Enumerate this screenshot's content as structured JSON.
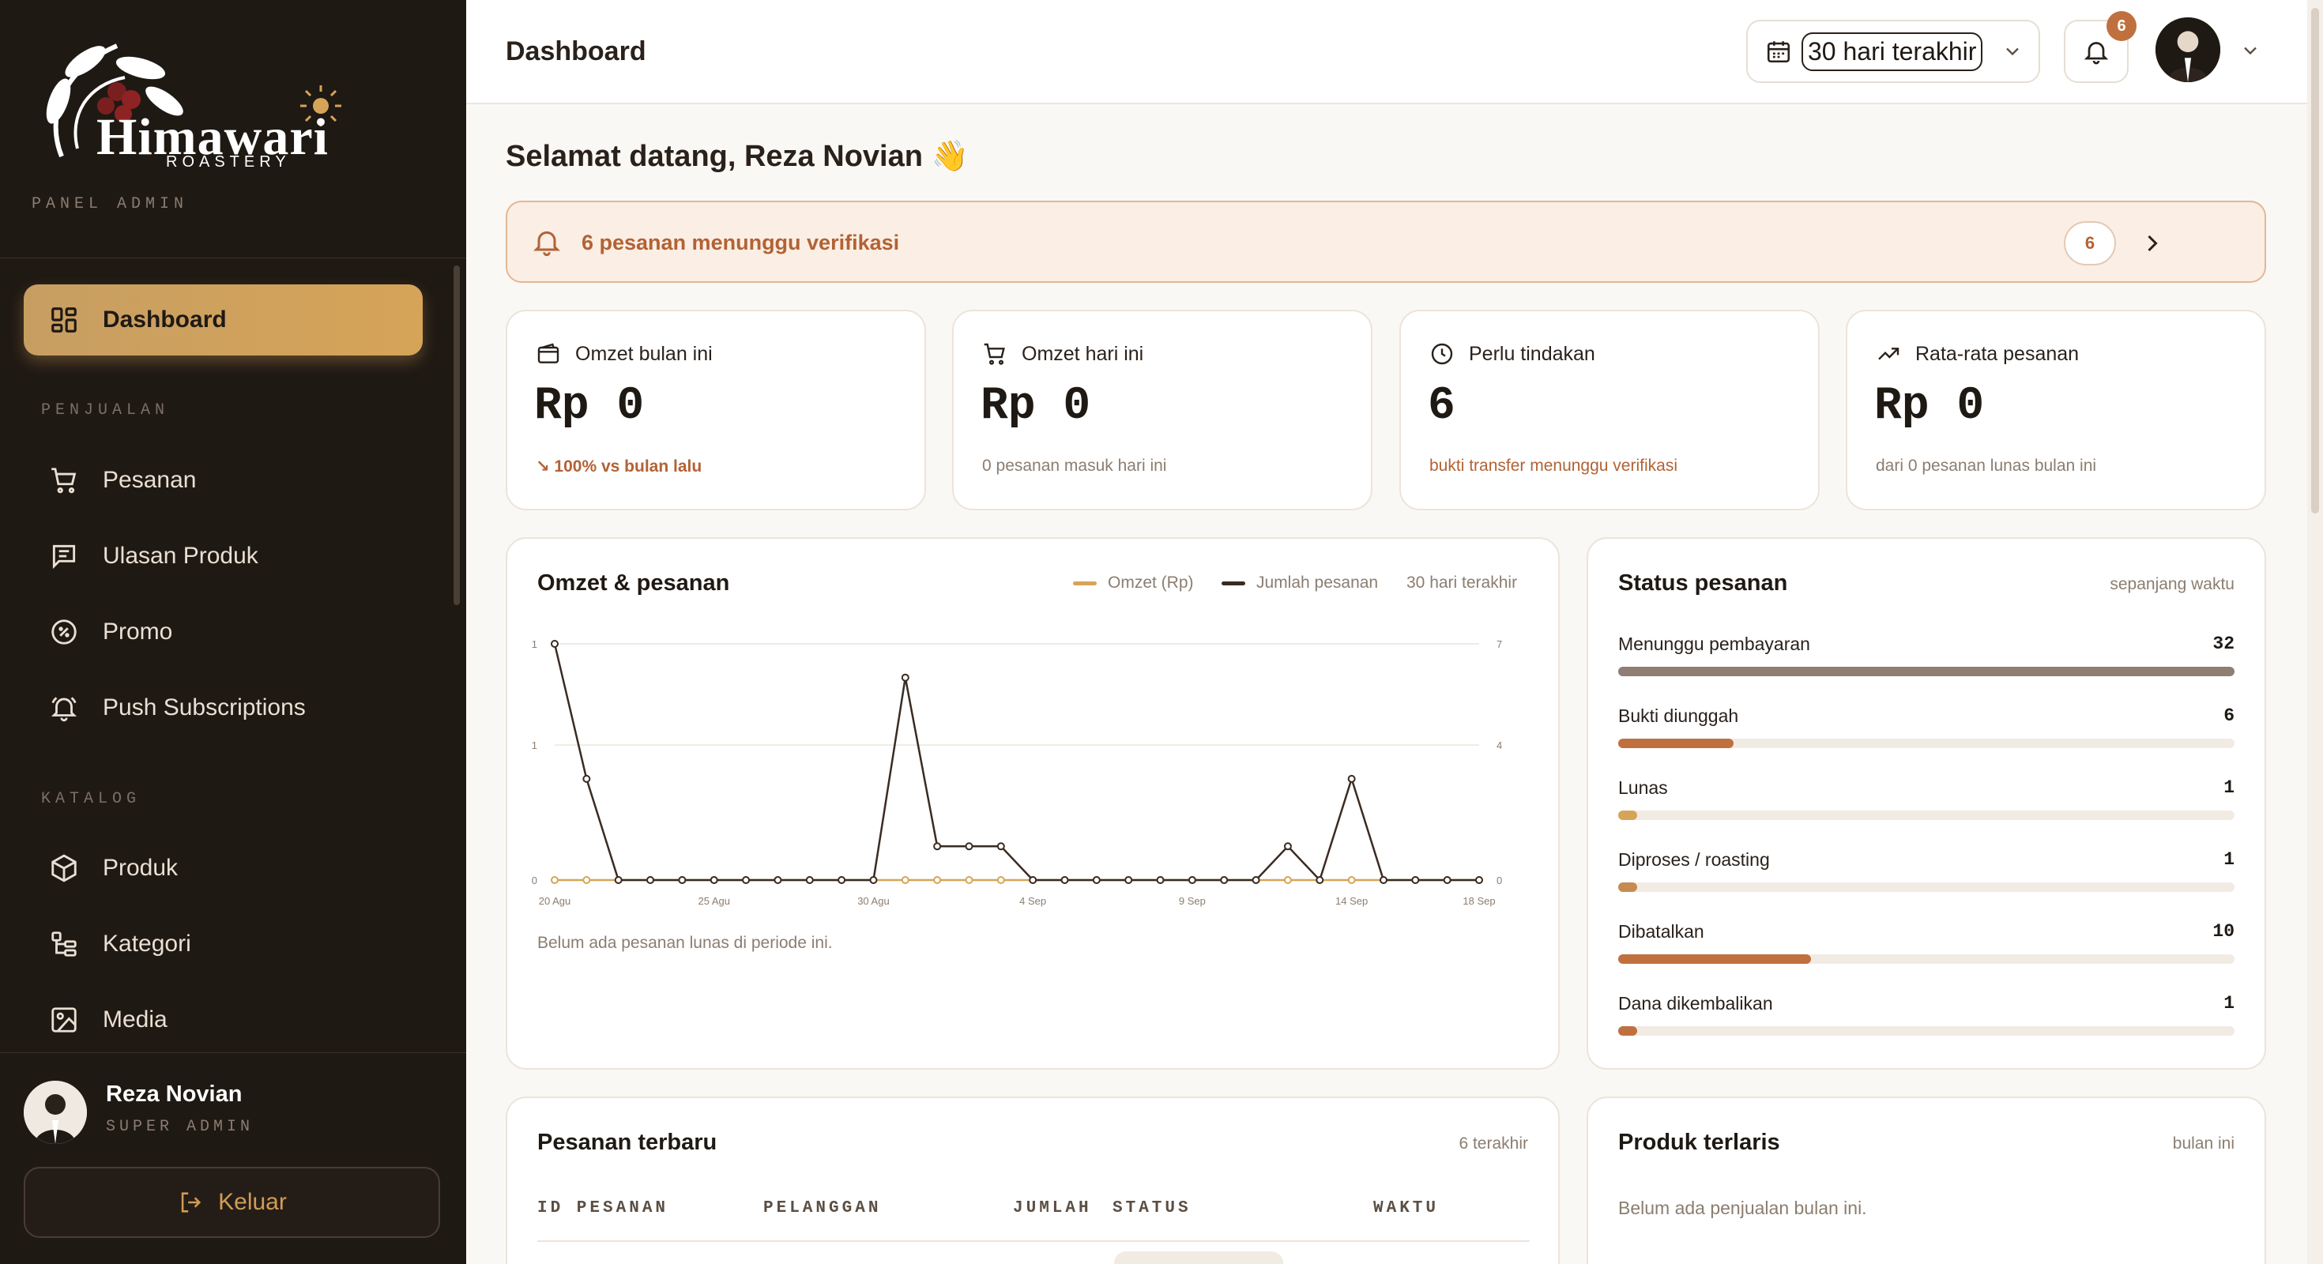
{
  "brand": {
    "name": "Himawari",
    "sub": "ROASTERY",
    "panel_label": "PANEL ADMIN"
  },
  "sidebar": {
    "sections": [
      "PENJUALAN",
      "KATALOG"
    ],
    "items": [
      {
        "label": "Dashboard",
        "icon": "dashboard-grid-icon",
        "active": true
      },
      {
        "label": "Pesanan",
        "icon": "cart-icon"
      },
      {
        "label": "Ulasan Produk",
        "icon": "review-icon"
      },
      {
        "label": "Promo",
        "icon": "promo-badge-icon"
      },
      {
        "label": "Push Subscriptions",
        "icon": "bell-ring-icon"
      },
      {
        "label": "Produk",
        "icon": "box-icon"
      },
      {
        "label": "Kategori",
        "icon": "category-tree-icon"
      },
      {
        "label": "Media",
        "icon": "image-icon"
      }
    ],
    "user": {
      "name": "Reza Novian",
      "role": "SUPER ADMIN"
    },
    "logout_label": "Keluar"
  },
  "topbar": {
    "title": "Dashboard",
    "range": "30 hari terakhir",
    "notif_count": "6"
  },
  "welcome": "Selamat datang, Reza Novian 👋",
  "alert": {
    "text": "6 pesanan menunggu verifikasi",
    "count": "6"
  },
  "stats": [
    {
      "label": "Omzet bulan ini",
      "icon": "wallet-icon",
      "value": "Rp 0",
      "sub": "↘  100% vs bulan lalu"
    },
    {
      "label": "Omzet hari ini",
      "icon": "cart-icon",
      "value": "Rp 0",
      "sub": "0 pesanan masuk hari ini"
    },
    {
      "label": "Perlu tindakan",
      "icon": "clock-icon",
      "value": "6",
      "sub": "bukti transfer menunggu verifikasi"
    },
    {
      "label": "Rata-rata pesanan",
      "icon": "trend-up-icon",
      "value": "Rp 0",
      "sub": "dari 0 pesanan lunas bulan ini"
    }
  ],
  "chart_card": {
    "title": "Omzet & pesanan",
    "legend_omzet": "Omzet (Rp)",
    "legend_orders": "Jumlah pesanan",
    "range_note": "30 hari terakhir",
    "empty_note": "Belum ada pesanan lunas di periode ini."
  },
  "chart_data": {
    "type": "line",
    "x": [
      "20 Agu",
      "21 Agu",
      "22 Agu",
      "23 Agu",
      "24 Agu",
      "25 Agu",
      "26 Agu",
      "27 Agu",
      "28 Agu",
      "29 Agu",
      "30 Agu",
      "31 Agu",
      "1 Sep",
      "2 Sep",
      "3 Sep",
      "4 Sep",
      "5 Sep",
      "6 Sep",
      "7 Sep",
      "8 Sep",
      "9 Sep",
      "10 Sep",
      "11 Sep",
      "12 Sep",
      "13 Sep",
      "14 Sep",
      "15 Sep",
      "16 Sep",
      "17 Sep",
      "18 Sep"
    ],
    "x_tick_labels": [
      "20 Agu",
      "25 Agu",
      "30 Agu",
      "4 Sep",
      "9 Sep",
      "14 Sep",
      "18 Sep"
    ],
    "left_axis_ticks": [
      "0",
      "1",
      "1"
    ],
    "right_axis_ticks": [
      "0",
      "4",
      "7"
    ],
    "series": [
      {
        "name": "Omzet (Rp)",
        "axis": "left",
        "values": [
          0,
          0,
          0,
          0,
          0,
          0,
          0,
          0,
          0,
          0,
          0,
          0,
          0,
          0,
          0,
          0,
          0,
          0,
          0,
          0,
          0,
          0,
          0,
          0,
          0,
          0,
          0,
          0,
          0,
          0
        ]
      },
      {
        "name": "Jumlah pesanan",
        "axis": "right",
        "values": [
          7,
          3,
          0,
          0,
          0,
          0,
          0,
          0,
          0,
          0,
          0,
          6,
          1,
          1,
          1,
          0,
          0,
          0,
          0,
          0,
          0,
          0,
          0,
          1,
          0,
          3,
          0,
          0,
          0,
          0
        ]
      }
    ],
    "ylim_right": [
      0,
      7
    ],
    "grid": true,
    "colors": {
      "omzet": "#d6a458",
      "orders": "#3a2b22"
    }
  },
  "status_card": {
    "title": "Status pesanan",
    "note": "sepanjang waktu",
    "max": 32,
    "rows": [
      {
        "name": "Menunggu pembayaran",
        "count": 32,
        "color": "#8f7e71"
      },
      {
        "name": "Bukti diunggah",
        "count": 6,
        "color": "#c0703e"
      },
      {
        "name": "Lunas",
        "count": 1,
        "color": "#d6a458"
      },
      {
        "name": "Diproses / roasting",
        "count": 1,
        "color": "#c68b4f"
      },
      {
        "name": "Dibatalkan",
        "count": 10,
        "color": "#c0703e"
      },
      {
        "name": "Dana dikembalikan",
        "count": 1,
        "color": "#c0703e"
      }
    ]
  },
  "recent_orders": {
    "title": "Pesanan terbaru",
    "note": "6 terakhir",
    "columns": [
      "ID PESANAN",
      "PELANGGAN",
      "JUMLAH",
      "STATUS",
      "WAKTU"
    ]
  },
  "best_sellers": {
    "title": "Produk terlaris",
    "note": "bulan ini",
    "empty": "Belum ada penjualan bulan ini."
  }
}
